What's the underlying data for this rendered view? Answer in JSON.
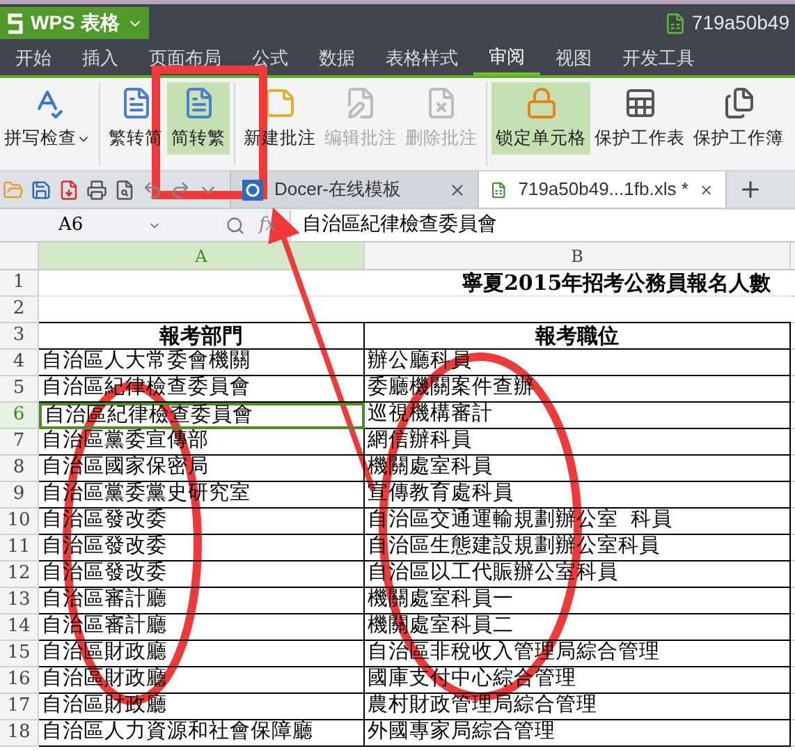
{
  "app_button": {
    "label": "WPS 表格"
  },
  "window": {
    "title": "719a50b49"
  },
  "menu_tabs": [
    {
      "label": "开始",
      "selected": false
    },
    {
      "label": "插入",
      "selected": false
    },
    {
      "label": "页面布局",
      "selected": false
    },
    {
      "label": "公式",
      "selected": false
    },
    {
      "label": "数据",
      "selected": false
    },
    {
      "label": "表格样式",
      "selected": false
    },
    {
      "label": "审阅",
      "selected": true
    },
    {
      "label": "视图",
      "selected": false
    },
    {
      "label": "开发工具",
      "selected": false
    }
  ],
  "ribbon": {
    "groups": [
      {
        "buttons": [
          {
            "label": "拼写检查",
            "active": false,
            "disabled": false,
            "has_menu": true
          }
        ]
      },
      {
        "buttons": [
          {
            "label": "繁转简",
            "active": false,
            "disabled": false,
            "has_menu": false
          },
          {
            "label": "简转繁",
            "active": true,
            "disabled": false,
            "has_menu": false
          }
        ]
      },
      {
        "buttons": [
          {
            "label": "新建批注",
            "active": false,
            "disabled": false,
            "has_menu": false
          },
          {
            "label": "编辑批注",
            "active": false,
            "disabled": true,
            "has_menu": false
          },
          {
            "label": "删除批注",
            "active": false,
            "disabled": true,
            "has_menu": false
          }
        ]
      },
      {
        "buttons": [
          {
            "label": "锁定单元格",
            "active": true,
            "disabled": false,
            "has_menu": false
          },
          {
            "label": "保护工作表",
            "active": false,
            "disabled": false,
            "has_menu": false
          },
          {
            "label": "保护工作簿",
            "active": false,
            "disabled": false,
            "has_menu": false
          }
        ]
      }
    ]
  },
  "doc_tabs": [
    {
      "label": "Docer-在线模板",
      "selected": false
    },
    {
      "label": "719a50b49...1fb.xls *",
      "selected": true
    }
  ],
  "formula_bar": {
    "name_box": "A6",
    "function_label": "fx",
    "value": "自治區紀律檢查委員會"
  },
  "sheet": {
    "columns": [
      {
        "label": "A",
        "selected": true
      },
      {
        "label": "B",
        "selected": false
      }
    ],
    "rows": [
      {
        "number": "1",
        "kind": "title",
        "selected": false,
        "text": "寧夏2015年招考公務員報名人數"
      },
      {
        "number": "2",
        "kind": "blank",
        "selected": false
      },
      {
        "number": "3",
        "kind": "header",
        "selected": false,
        "cells": [
          "報考部門",
          "報考職位"
        ]
      },
      {
        "number": "4",
        "kind": "data",
        "selected": false,
        "cells": [
          "自治區人大常委會機關",
          "辦公廳科員"
        ]
      },
      {
        "number": "5",
        "kind": "data",
        "selected": false,
        "cells": [
          "自治區紀律檢查委員會",
          "委廳機關案件查辦"
        ]
      },
      {
        "number": "6",
        "kind": "data",
        "selected": true,
        "cells": [
          "自治區紀律檢查委員會",
          "巡視機構審計"
        ]
      },
      {
        "number": "7",
        "kind": "data",
        "selected": false,
        "cells": [
          "自治區黨委宣傳部",
          "網信辦科員"
        ]
      },
      {
        "number": "8",
        "kind": "data",
        "selected": false,
        "cells": [
          "自治區國家保密局",
          "機關處室科員"
        ]
      },
      {
        "number": "9",
        "kind": "data",
        "selected": false,
        "cells": [
          "自治區黨委黨史研究室",
          "宣傳教育處科員"
        ]
      },
      {
        "number": "10",
        "kind": "data",
        "selected": false,
        "cells": [
          "自治區發改委",
          "自治區交通運輸規劃辦公室  科員"
        ]
      },
      {
        "number": "11",
        "kind": "data",
        "selected": false,
        "cells": [
          "自治區發改委",
          "自治區生態建設規劃辦公室科員"
        ]
      },
      {
        "number": "12",
        "kind": "data",
        "selected": false,
        "cells": [
          "自治區發改委",
          "自治區以工代賑辦公室科員"
        ]
      },
      {
        "number": "13",
        "kind": "data",
        "selected": false,
        "cells": [
          "自治區審計廳",
          "機關處室科員一"
        ]
      },
      {
        "number": "14",
        "kind": "data",
        "selected": false,
        "cells": [
          "自治區審計廳",
          "機關處室科員二"
        ]
      },
      {
        "number": "15",
        "kind": "data",
        "selected": false,
        "cells": [
          "自治區財政廳",
          "自治區非稅收入管理局綜合管理"
        ]
      },
      {
        "number": "16",
        "kind": "data",
        "selected": false,
        "cells": [
          "自治區財政廳",
          "國庫支付中心綜合管理"
        ]
      },
      {
        "number": "17",
        "kind": "data",
        "selected": false,
        "cells": [
          "自治區財政廳",
          "農村財政管理局綜合管理"
        ]
      },
      {
        "number": "18",
        "kind": "data",
        "selected": false,
        "cells": [
          "自治區人力資源和社會保障廳",
          "外國專家局綜合管理"
        ]
      }
    ]
  }
}
